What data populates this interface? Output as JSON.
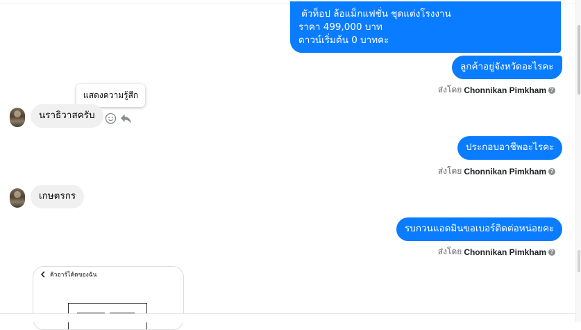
{
  "messages": {
    "msg1_lines": [
      "ตัวท็อป ล้อแม็กแฟชั่น ชุดแต่งโรงงาน",
      "ราคา 499,000 บาท",
      "ดาวน์เริ่มต้น 0 บาทคะ"
    ],
    "msg2": "ลูกค้าอยู่จังหวัดอะไรคะ",
    "msg3": "ประกอบอาชีพอะไรคะ",
    "msg4": "รบกวนแอดมินขอเบอร์ติดต่อหน่อยคะ",
    "reply1": "นราธิวาสครับ",
    "reply2": "เกษตรกร"
  },
  "sent_by": {
    "prefix": "ส่งโดย",
    "name": "Chonnikan Pimkham"
  },
  "tooltip": "แสดงความรู้สึก",
  "image_card": {
    "header": "คิวอาร์โค้ดของฉัน"
  },
  "colors": {
    "outgoing_bubble": "#0a7cff",
    "incoming_bubble": "#f0f0f0",
    "meta_text": "#65676b"
  },
  "icons": [
    "react-smiley-icon",
    "reply-arrow-icon",
    "help-circle-icon",
    "back-chevron-icon"
  ]
}
